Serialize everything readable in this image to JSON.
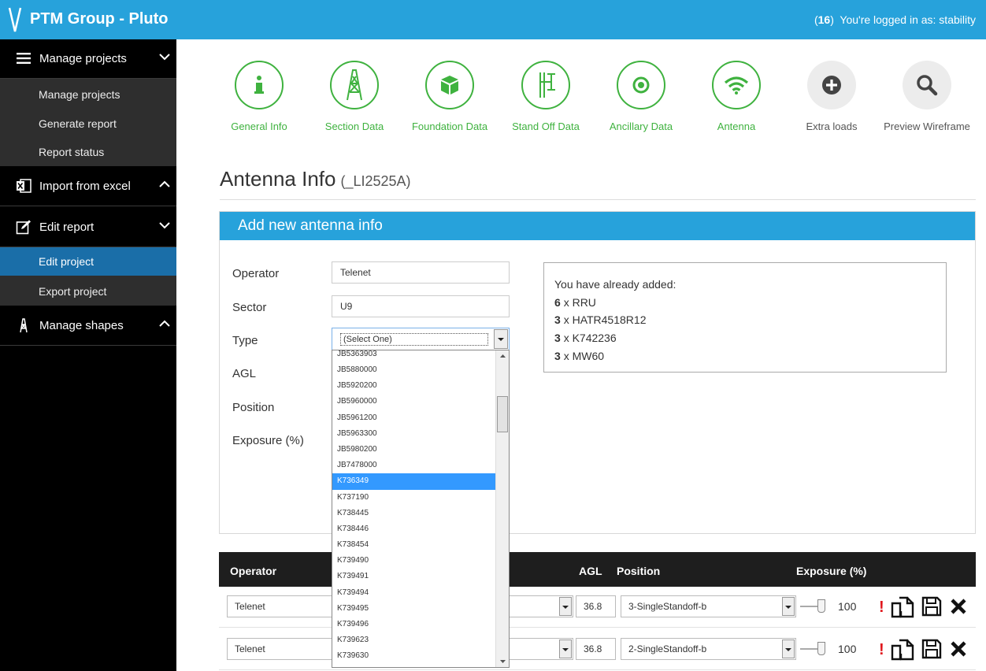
{
  "header": {
    "brand": "PTM Group - Pluto",
    "count": "16",
    "login_text": "You're logged in as: stability"
  },
  "sidebar": {
    "sections": [
      {
        "label": "Manage projects",
        "items": [
          "Manage projects",
          "Generate report",
          "Report status"
        ]
      },
      {
        "label": "Import from excel"
      },
      {
        "label": "Edit report",
        "items": [
          "Edit project",
          "Export project"
        ],
        "active": "Edit project"
      },
      {
        "label": "Manage shapes"
      }
    ]
  },
  "steps": [
    {
      "label": "General Info",
      "icon": "info-icon"
    },
    {
      "label": "Section Data",
      "icon": "tower-icon"
    },
    {
      "label": "Foundation Data",
      "icon": "cube-icon"
    },
    {
      "label": "Stand Off Data",
      "icon": "standoff-icon"
    },
    {
      "label": "Ancillary Data",
      "icon": "target-icon"
    },
    {
      "label": "Antenna",
      "icon": "wifi-icon"
    },
    {
      "label": "Extra loads",
      "icon": "plus-icon"
    },
    {
      "label": "Preview Wireframe",
      "icon": "search-icon"
    }
  ],
  "page": {
    "title": "Antenna Info",
    "subtitle": "(_LI2525A)"
  },
  "form": {
    "heading": "Add new antenna info",
    "labels": {
      "operator": "Operator",
      "sector": "Sector",
      "type": "Type",
      "agl": "AGL",
      "position": "Position",
      "exposure": "Exposure (%)"
    },
    "operator_value": "Telenet",
    "sector_value": "U9",
    "type_value": "(Select One)"
  },
  "summary": {
    "intro": "You have already added:",
    "lines": [
      {
        "qty": "6",
        "text": "x RRU"
      },
      {
        "qty": "3",
        "text": "x HATR4518R12"
      },
      {
        "qty": "3",
        "text": "x K742236"
      },
      {
        "qty": "3",
        "text": "x MW60"
      }
    ]
  },
  "dropdown": {
    "options": [
      "JB5363903",
      "JB5880000",
      "JB5920200",
      "JB5960000",
      "JB5961200",
      "JB5963300",
      "JB5980200",
      "JB7478000",
      "K736349",
      "K737190",
      "K738445",
      "K738446",
      "K738454",
      "K739490",
      "K739491",
      "K739494",
      "K739495",
      "K739496",
      "K739623",
      "K739630"
    ],
    "highlighted": "K736349"
  },
  "table": {
    "headers": {
      "operator": "Operator",
      "agl": "AGL",
      "position": "Position",
      "exposure": "Exposure (%)"
    },
    "rows": [
      {
        "operator": "Telenet",
        "agl": "36.8",
        "position": "3-SingleStandoff-b",
        "exposure": "100"
      },
      {
        "operator": "Telenet",
        "agl": "36.8",
        "position": "2-SingleStandoff-b",
        "exposure": "100"
      }
    ],
    "warning_mark": "!"
  },
  "colors": {
    "accent": "#27a2db",
    "done": "#3fb23f",
    "active_nav": "#1a6ea8",
    "warning": "#e0161c"
  }
}
